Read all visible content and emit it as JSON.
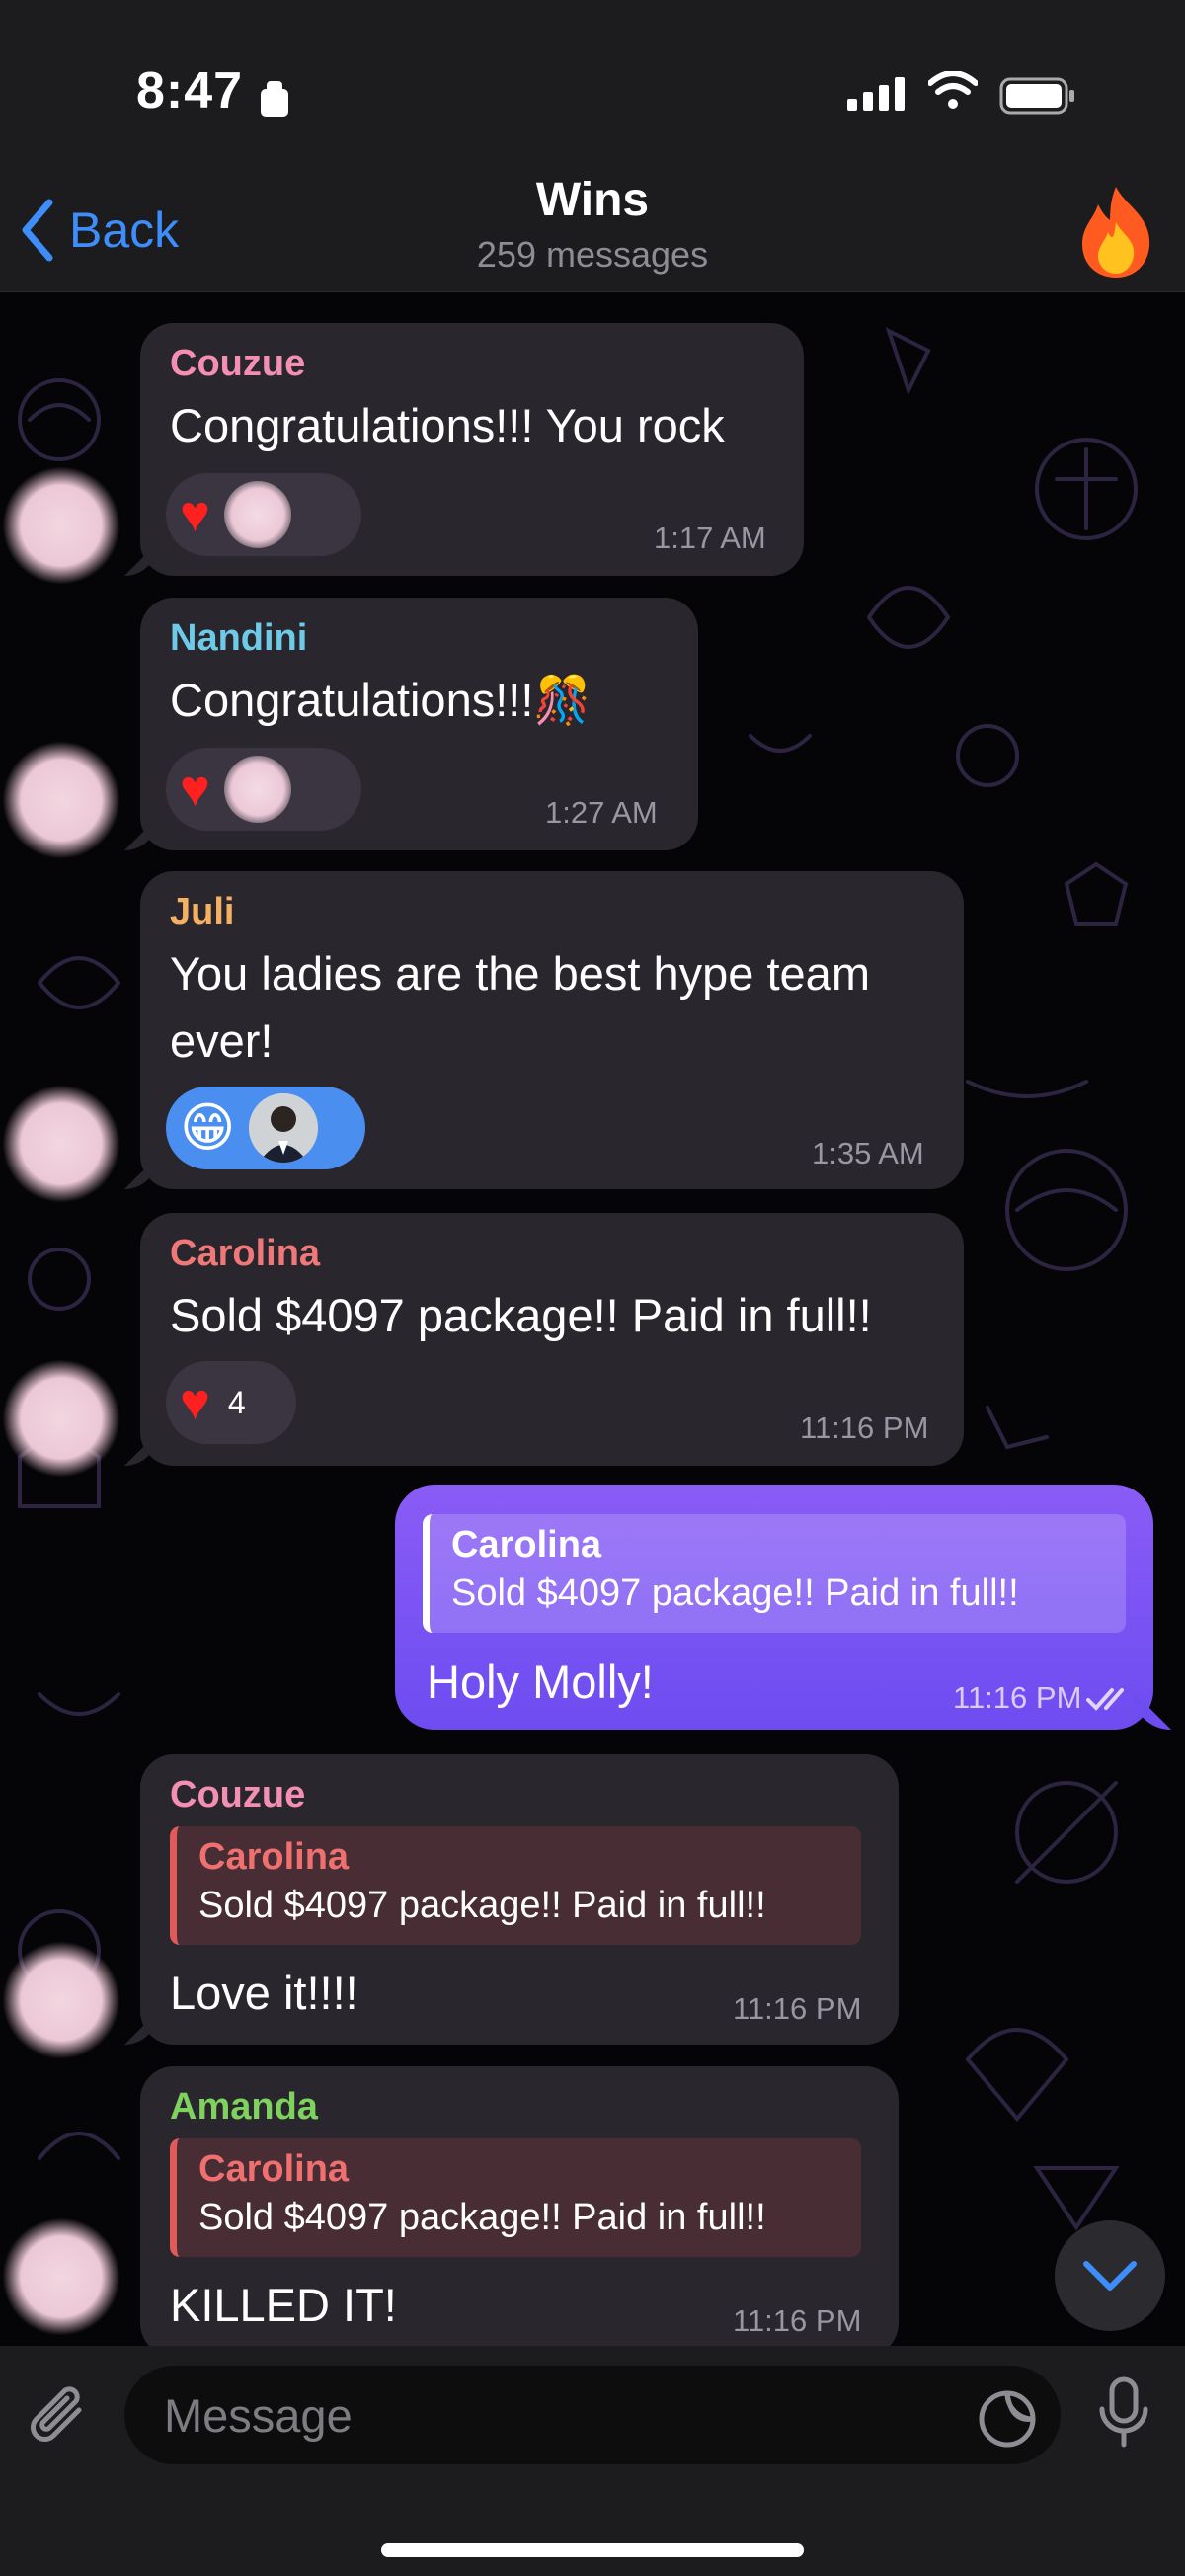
{
  "status": {
    "time": "8:47"
  },
  "header": {
    "back_label": "Back",
    "title": "Wins",
    "subtitle": "259 messages",
    "avatar_emoji": "🔥"
  },
  "messages": [
    {
      "sender": "Couzue",
      "sender_color": "#f48fb1",
      "text": "Congratulations!!! You rock",
      "time": "1:17 AM",
      "reaction": "heart"
    },
    {
      "sender": "Nandini",
      "sender_color": "#6dcbe8",
      "text": "Congratulations!!!🎊",
      "time": "1:27 AM",
      "reaction": "heart"
    },
    {
      "sender": "Juli",
      "sender_color": "#f5b062",
      "text": "You ladies are the best hype team",
      "text2": "ever!",
      "time": "1:35 AM",
      "reaction": "grin",
      "reaction_emoji": "😁"
    },
    {
      "sender": "Carolina",
      "sender_color": "#f07878",
      "text": "Sold $4097 package!! Paid in full!!",
      "time": "11:16 PM",
      "reaction": "heart",
      "reaction_count": "4"
    },
    {
      "outgoing": true,
      "reply_name": "Carolina",
      "reply_text": "Sold $4097 package!! Paid in full!!",
      "text": "Holy Molly!",
      "time": "11:16 PM",
      "bubble_color": "#7a55f3"
    },
    {
      "sender": "Couzue",
      "sender_color": "#f48fb1",
      "reply_name": "Carolina",
      "reply_text": "Sold $4097 package!! Paid in full!!",
      "text": "Love it!!!!",
      "time": "11:16 PM"
    },
    {
      "sender": "Amanda",
      "sender_color": "#7ed35e",
      "reply_name": "Carolina",
      "reply_text": "Sold $4097 package!! Paid in full!!",
      "text": "KILLED IT!",
      "time": "11:16 PM"
    }
  ],
  "input": {
    "placeholder": "Message"
  },
  "colors": {
    "accent": "#3e8dfa",
    "incoming_bubble": "#2a262e",
    "outgoing_bubble": "#7a55f3"
  }
}
